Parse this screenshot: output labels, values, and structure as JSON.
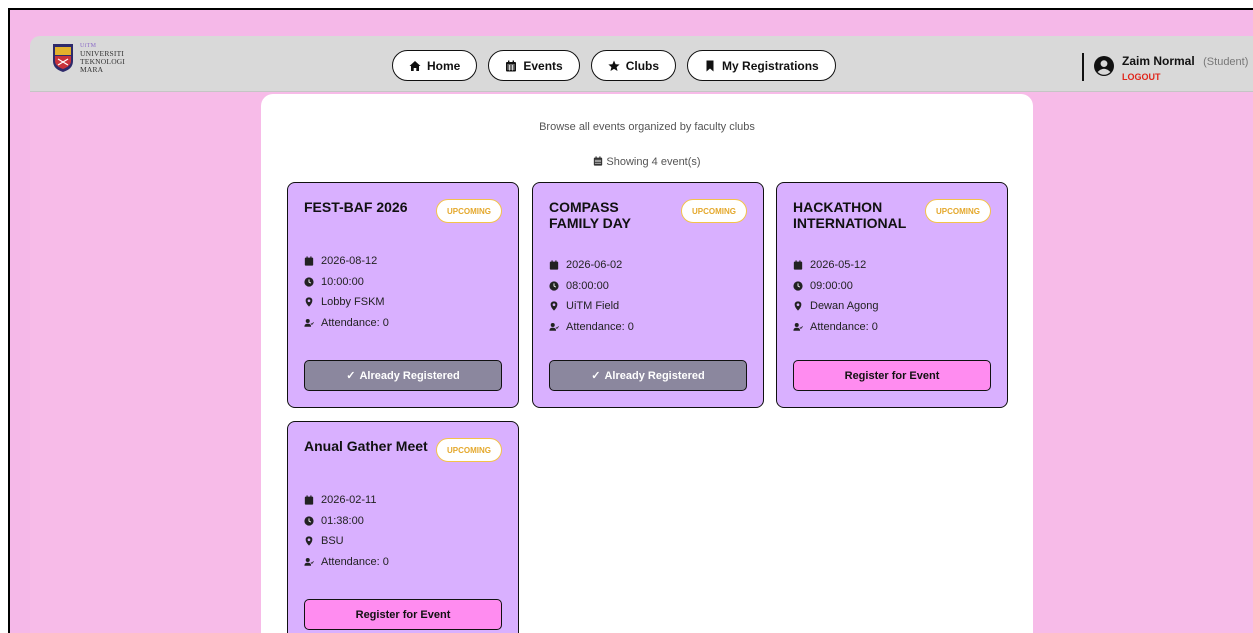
{
  "brand": {
    "top_line": "UiTM",
    "lines": [
      "UNIVERSITI",
      "TEKNOLOGI",
      "MARA"
    ]
  },
  "nav": {
    "items": [
      {
        "label": "Home",
        "icon": "home-icon"
      },
      {
        "label": "Events",
        "icon": "calendar-icon"
      },
      {
        "label": "Clubs",
        "icon": "star-icon"
      },
      {
        "label": "My Registrations",
        "icon": "bookmark-icon"
      }
    ]
  },
  "user": {
    "name": "Zaim Normal",
    "role": "(Student)",
    "logout_label": "LOGOUT"
  },
  "page": {
    "subtitle": "Browse all events organized by faculty clubs",
    "count_text": "Showing 4 event(s)"
  },
  "events": [
    {
      "title": "FEST-BAF 2026",
      "status": "UPCOMING",
      "date": "2026-08-12",
      "time": "10:00:00",
      "location": "Lobby FSKM",
      "attendance": "Attendance: 0",
      "action": "Already Registered",
      "registered": true
    },
    {
      "title": "COMPASS FAMILY DAY",
      "status": "UPCOMING",
      "date": "2026-06-02",
      "time": "08:00:00",
      "location": "UiTM Field",
      "attendance": "Attendance: 0",
      "action": "Already Registered",
      "registered": true
    },
    {
      "title": "HACKATHON INTERNATIONAL",
      "status": "UPCOMING",
      "date": "2026-05-12",
      "time": "09:00:00",
      "location": "Dewan Agong",
      "attendance": "Attendance: 0",
      "action": "Register for Event",
      "registered": false
    },
    {
      "title": "Anual Gather Meet",
      "status": "UPCOMING",
      "date": "2026-02-11",
      "time": "01:38:00",
      "location": "BSU",
      "attendance": "Attendance: 0",
      "action": "Register for Event",
      "registered": false
    }
  ],
  "colors": {
    "background_pink": "#f7bbe8",
    "card_purple": "#d9b0ff",
    "register_pink": "#ff8cf0",
    "registered_gray": "#8b879e",
    "badge_gold": "#e4a82c",
    "logout_red": "#e0261b"
  }
}
